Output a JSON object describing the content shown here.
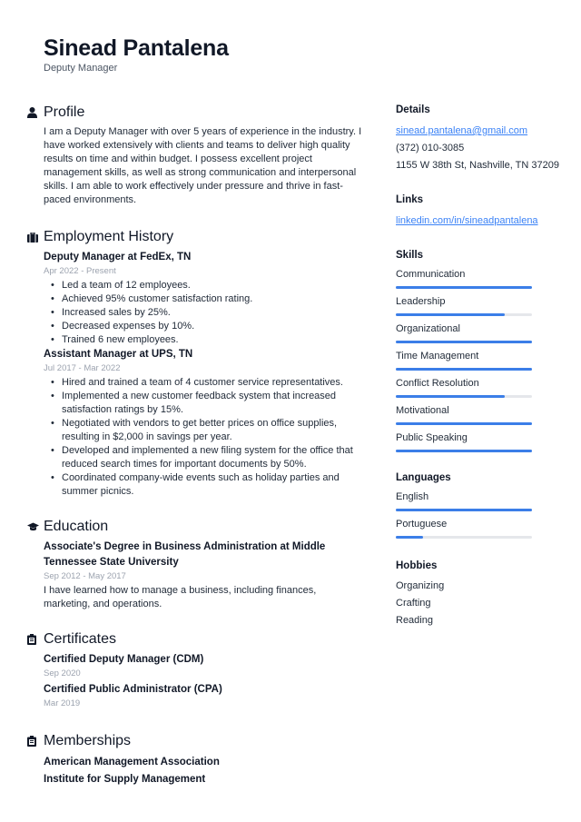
{
  "header": {
    "name": "Sinead Pantalena",
    "title": "Deputy Manager"
  },
  "profile": {
    "heading": "Profile",
    "icon": "person-icon",
    "text": "I am a Deputy Manager with over 5 years of experience in the industry. I have worked extensively with clients and teams to deliver high quality results on time and within budget. I possess excellent project management skills, as well as strong communication and interpersonal skills. I am able to work effectively under pressure and thrive in fast-paced environments."
  },
  "employment": {
    "heading": "Employment History",
    "icon": "briefcase-icon",
    "jobs": [
      {
        "title": "Deputy Manager at FedEx, TN",
        "dates": "Apr 2022 - Present",
        "bullets": [
          "Led a team of 12 employees.",
          "Achieved 95% customer satisfaction rating.",
          "Increased sales by 25%.",
          "Decreased expenses by 10%.",
          "Trained 6 new employees."
        ]
      },
      {
        "title": "Assistant Manager at UPS, TN",
        "dates": "Jul 2017 - Mar 2022",
        "bullets": [
          "Hired and trained a team of 4 customer service representatives.",
          "Implemented a new customer feedback system that increased satisfaction ratings by 15%.",
          "Negotiated with vendors to get better prices on office supplies, resulting in $2,000 in savings per year.",
          "Developed and implemented a new filing system for the office that reduced search times for important documents by 50%.",
          "Coordinated company-wide events such as holiday parties and summer picnics."
        ]
      }
    ]
  },
  "education": {
    "heading": "Education",
    "icon": "graduation-cap-icon",
    "items": [
      {
        "title": "Associate's Degree in Business Administration at Middle Tennessee State University",
        "dates": "Sep 2012 - May 2017",
        "description": "I have learned how to manage a business, including finances, marketing, and operations."
      }
    ]
  },
  "certificates": {
    "heading": "Certificates",
    "icon": "clipboard-icon",
    "items": [
      {
        "title": "Certified Deputy Manager (CDM)",
        "date": "Sep 2020"
      },
      {
        "title": "Certified Public Administrator (CPA)",
        "date": "Mar 2019"
      }
    ]
  },
  "memberships": {
    "heading": "Memberships",
    "icon": "clipboard-icon",
    "items": [
      "American Management Association",
      "Institute for Supply Management"
    ]
  },
  "details": {
    "heading": "Details",
    "email": "sinead.pantalena@gmail.com",
    "phone": "(372) 010-3085",
    "address": "1155 W 38th St, Nashville, TN 37209"
  },
  "links": {
    "heading": "Links",
    "items": [
      "linkedin.com/in/sineadpantalena"
    ]
  },
  "skills": {
    "heading": "Skills",
    "accent_color": "#3b7ee8",
    "items": [
      {
        "name": "Communication",
        "level": 1.0
      },
      {
        "name": "Leadership",
        "level": 0.8
      },
      {
        "name": "Organizational",
        "level": 1.0
      },
      {
        "name": "Time Management",
        "level": 1.0
      },
      {
        "name": "Conflict Resolution",
        "level": 0.8
      },
      {
        "name": "Motivational",
        "level": 1.0
      },
      {
        "name": "Public Speaking",
        "level": 1.0
      }
    ]
  },
  "languages": {
    "heading": "Languages",
    "items": [
      {
        "name": "English",
        "level": 1.0
      },
      {
        "name": "Portuguese",
        "level": 0.2
      }
    ]
  },
  "hobbies": {
    "heading": "Hobbies",
    "items": [
      "Organizing",
      "Crafting",
      "Reading"
    ]
  }
}
